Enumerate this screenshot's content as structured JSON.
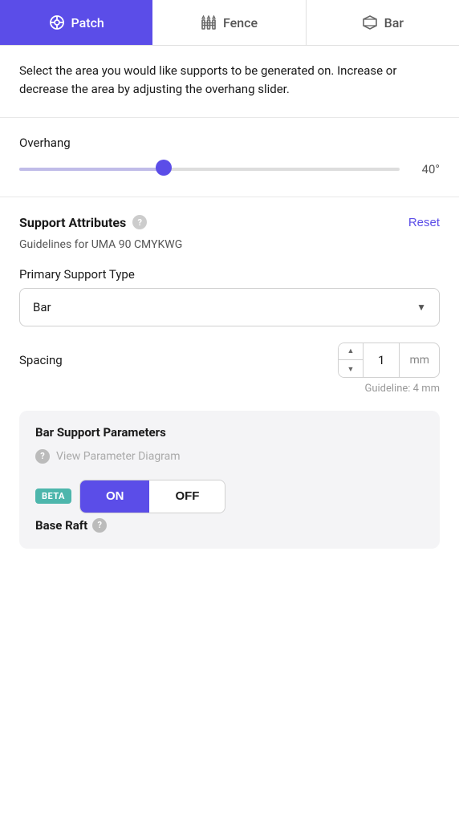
{
  "tabs": [
    {
      "id": "patch",
      "label": "Patch",
      "active": true,
      "icon": "patch-icon"
    },
    {
      "id": "fence",
      "label": "Fence",
      "active": false,
      "icon": "fence-icon"
    },
    {
      "id": "bar",
      "label": "Bar",
      "active": false,
      "icon": "bar-icon"
    }
  ],
  "description": {
    "text": "Select the area you would like supports to be generated on. Increase or decrease the area by adjusting the overhang slider."
  },
  "overhang": {
    "label": "Overhang",
    "value": "40°",
    "sliderPercent": 38
  },
  "support_attributes": {
    "title": "Support Attributes",
    "reset_label": "Reset",
    "guidelines": "Guidelines for UMA 90 CMYKWG",
    "primary_support_type": {
      "label": "Primary Support Type",
      "value": "Bar"
    },
    "spacing": {
      "label": "Spacing",
      "value": "1",
      "unit": "mm",
      "guideline": "Guideline: 4 mm"
    }
  },
  "bar_support_params": {
    "title": "Bar Support Parameters",
    "view_diagram": "View Parameter Diagram",
    "beta_badge": "BETA",
    "base_raft": {
      "label": "Base Raft",
      "on_label": "ON",
      "off_label": "OFF",
      "active": "on"
    }
  },
  "icons": {
    "help": "?",
    "chevron_down": "▼",
    "stepper_up": "▲",
    "stepper_down": "▼"
  }
}
